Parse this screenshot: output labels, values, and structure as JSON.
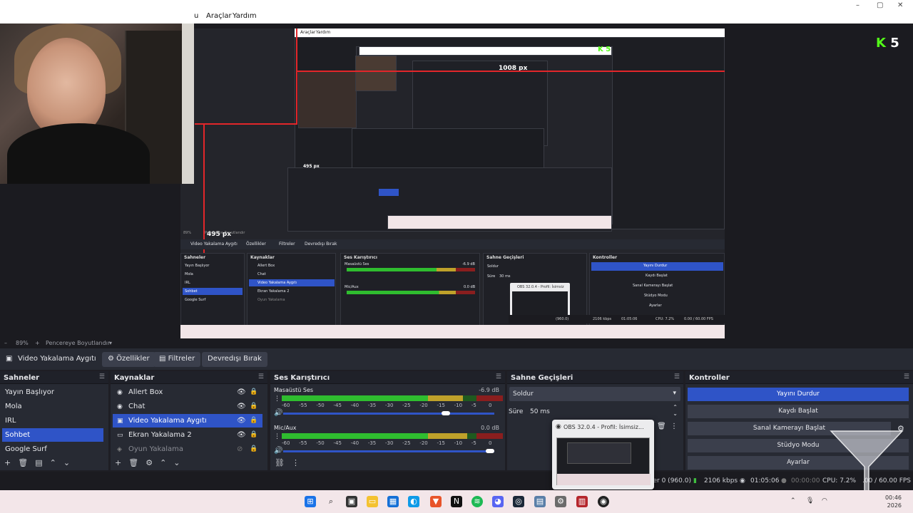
{
  "menubar": {
    "items": [
      "Araçlar",
      "Yardım"
    ],
    "partial_left": "u"
  },
  "window_controls": [
    "–",
    "▢",
    "✕"
  ],
  "brand": {
    "letter": "K",
    "number": "5"
  },
  "preview": {
    "menu_items": [
      "Araçlar",
      "Yardım"
    ],
    "label_1008": "1008 px",
    "label_495": "495 px",
    "label_495b": "495 px",
    "inner_kick": "5",
    "mini_scenes_title": "Sahneler",
    "mini_sources_title": "Kaynaklar",
    "mini_mixer_title": "Ses Karıştırıcı",
    "mini_transitions_title": "Sahne Geçişleri",
    "mini_controls_title": "Kontroller",
    "mini_stop": "Yayını Durdur",
    "mini_record": "Kaydı Başlat",
    "mini_virtualcam": "Sanal Kamerayı Başlat",
    "mini_studio": "Stüdyo Modu",
    "mini_settings": "Ayarlar",
    "mini_popup_title": "OBS 32.0.4 - Profil: İsimsiz",
    "mini_srcname": "Video Yakalama Aygıtı",
    "mini_props": "Özellikler",
    "mini_filters": "Filtreler",
    "mini_deact": "Devredışı Bırak",
    "mini_scenes": [
      "Yayın Başlıyor",
      "Mola",
      "IRL",
      "Sohbet",
      "Google Surf"
    ],
    "mini_sources": [
      "Allert Box",
      "Chat",
      "Video Yakalama Aygıtı",
      "Ekran Yakalama 2",
      "Oyun Yakalama"
    ],
    "mini_desktop": "Masaüstü Ses",
    "mini_mic": "Mic/Aux",
    "mini_desktop_db": "-6.9 dB",
    "mini_mic_db": "0.0 dB",
    "mini_fade": "Soldur",
    "mini_dur_label": "Süre",
    "mini_dur": "30 ms",
    "mini_zoom": "89%",
    "mini_fit": "Pencereye Boyutlandır",
    "mini_kbps": "2106 kbps",
    "mini_time": "01:05:06",
    "mini_cpu": "CPU: 7.2%",
    "mini_fps": "0.00 / 60.00 FPS",
    "mini_stat": "(960.0)"
  },
  "zoombar": {
    "minus": "–",
    "zoom": "89%",
    "plus": "+",
    "fit": "Pencereye Boyutlandır",
    "chevron": "▾"
  },
  "source_toolbar": {
    "source_name": "Video Yakalama Aygıtı",
    "properties": "Özellikler",
    "filters": "Filtreler",
    "deactivate": "Devredışı Bırak"
  },
  "scenes": {
    "title": "Sahneler",
    "items": [
      "Yayın Başlıyor",
      "Mola",
      "IRL",
      "Sohbet",
      "Google Surf"
    ],
    "selected_index": 3
  },
  "sources": {
    "title": "Kaynaklar",
    "items": [
      "Allert Box",
      "Chat",
      "Video Yakalama Aygıtı",
      "Ekran Yakalama 2",
      "Oyun Yakalama"
    ],
    "selected_index": 2
  },
  "mixer": {
    "title": "Ses Karıştırıcı",
    "channels": [
      {
        "name": "Masaüstü Ses",
        "db": "-6.9 dB",
        "level": 0.7,
        "volume": 0.78
      },
      {
        "name": "Mic/Aux",
        "db": "0.0 dB",
        "level": 0.72,
        "volume": 1.0
      }
    ],
    "scale": [
      "-60",
      "-55",
      "-50",
      "-45",
      "-40",
      "-35",
      "-30",
      "-25",
      "-20",
      "-15",
      "-10",
      "-5",
      "0"
    ]
  },
  "transitions": {
    "title": "Sahne Geçişleri",
    "selected": "Soldur",
    "duration_label": "Süre",
    "duration": "50 ms"
  },
  "controls": {
    "title": "Kontroller",
    "buttons": [
      "Yayını Durdur",
      "Kaydı Başlat",
      "Sanal Kamerayı Başlat",
      "Stüdyo Modu",
      "Ayarlar"
    ]
  },
  "status": {
    "frames": "ler 0 (960.0)",
    "bitrate": "2106 kbps",
    "stream_time": "01:05:06",
    "rec_time": "00:00:00",
    "cpu": "CPU: 7.2%",
    "fps": ".00 / 60.00 FPS"
  },
  "popup": {
    "title": "OBS 32.0.4 - Profil: İsimsiz..."
  },
  "clock": {
    "time": "00:46",
    "date": "2026"
  },
  "colors": {
    "accent": "#2f54c7",
    "kick": "#53fc18",
    "rec_red": "#e2262a"
  }
}
